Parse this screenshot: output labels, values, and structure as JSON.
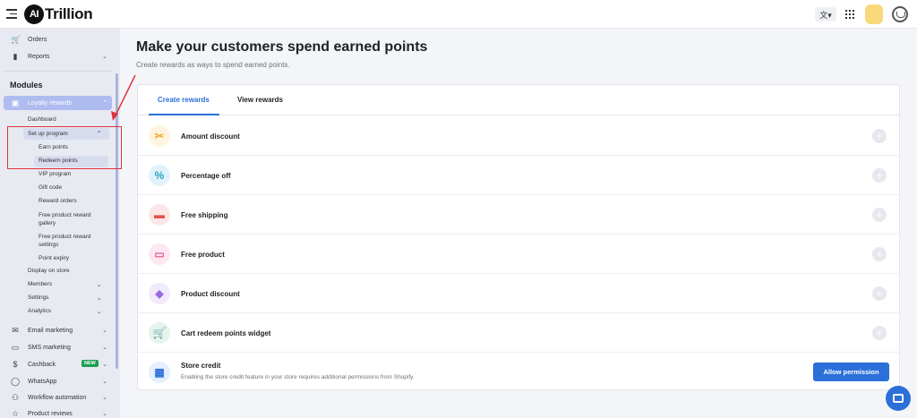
{
  "app": {
    "name": "Trillion",
    "badge": "AI"
  },
  "sidebar": {
    "top_items": [
      {
        "label": "Orders",
        "icon": "cart-icon"
      },
      {
        "label": "Reports",
        "icon": "bar-chart-icon"
      }
    ],
    "heading": "Modules",
    "active_module": "Loyalty rewards",
    "loyalty_items": [
      "Dashboard",
      "Set up program"
    ],
    "setup_items": [
      "Earn points",
      "Redeem points"
    ],
    "more_items": [
      "VIP program",
      "Gift code",
      "Reward orders",
      "Free product reward gallery",
      "Free product reward settings",
      "Point expiry"
    ],
    "bottom_loyalty": [
      "Display on store",
      "Members",
      "Settings",
      "Analytics"
    ],
    "modules": [
      {
        "label": "Email marketing",
        "icon": "mail-icon"
      },
      {
        "label": "SMS marketing",
        "icon": "sms-icon"
      },
      {
        "label": "Cashback",
        "icon": "cashback-icon",
        "badge": "NEW"
      },
      {
        "label": "WhatsApp",
        "icon": "whatsapp-icon"
      },
      {
        "label": "Workflow automation",
        "icon": "workflow-icon"
      },
      {
        "label": "Product reviews",
        "icon": "star-icon"
      }
    ]
  },
  "main": {
    "title": "Make your customers spend earned points",
    "subtitle": "Create rewards as ways to spend earned points.",
    "tabs": [
      "Create rewards",
      "View rewards"
    ],
    "rewards": [
      {
        "label": "Amount discount",
        "icon": "scissors-icon",
        "color": "#f5a623",
        "bg": "#fff4e0"
      },
      {
        "label": "Percentage off",
        "icon": "percent-icon",
        "color": "#2aa3c8",
        "bg": "#e1f3fa"
      },
      {
        "label": "Free shipping",
        "icon": "truck-icon",
        "color": "#e2524c",
        "bg": "#fde7e6"
      },
      {
        "label": "Free product",
        "icon": "ticket-icon",
        "color": "#e85a9b",
        "bg": "#fde8f1"
      },
      {
        "label": "Product discount",
        "icon": "tag-icon",
        "color": "#9a6be0",
        "bg": "#f1e9fc"
      },
      {
        "label": "Cart redeem points widget",
        "icon": "cart-widget-icon",
        "color": "#2f9e5a",
        "bg": "#e3f4ea"
      }
    ],
    "store_credit": {
      "label": "Store credit",
      "description": "Enabling the store credit feature in your store requires additional permissions from Shopify.",
      "button": "Allow permission"
    }
  }
}
